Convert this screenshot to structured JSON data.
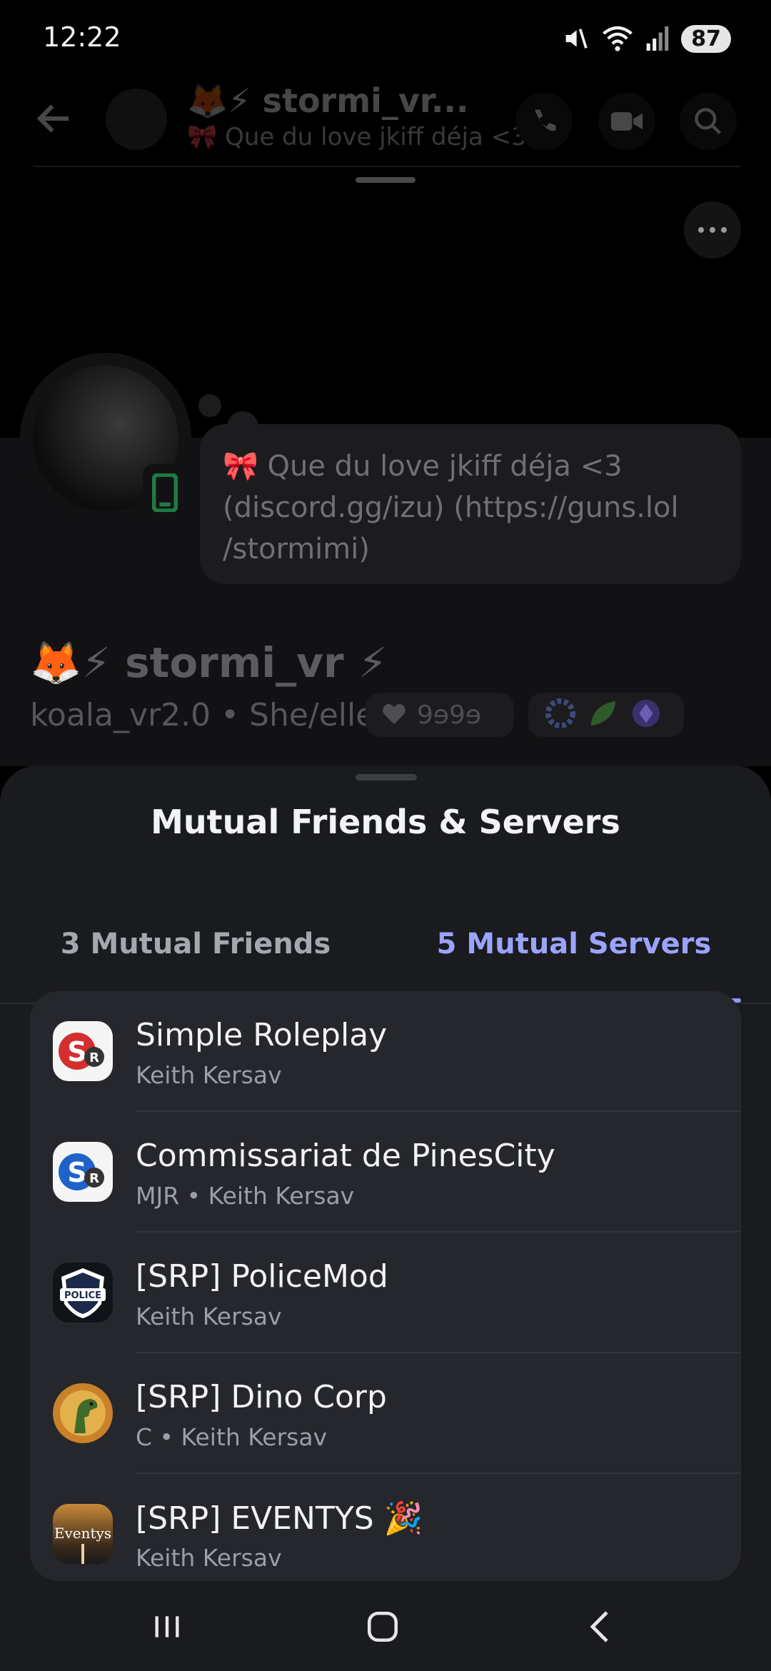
{
  "status_bar": {
    "time": "12:22",
    "battery": "87",
    "icons": [
      "mute-icon",
      "wifi-icon",
      "signal-icon"
    ]
  },
  "chat_header": {
    "name": "🦊⚡ stormi_vr...",
    "status": "🎀 Que du love jkiff déja <3..."
  },
  "profile": {
    "bio": "🎀  Que du love jkiff déja <3 (discord.gg/izu) (https://guns.lol /stormimi)",
    "display_name": "🦊⚡ stormi_vr ⚡",
    "tagline": "koala_vr2.0 • She/elle",
    "clan_tag": "9ɘ9ɘ"
  },
  "sheet": {
    "title": "Mutual Friends & Servers",
    "tabs": [
      {
        "label": "3 Mutual Friends",
        "selected": false
      },
      {
        "label": "5 Mutual Servers",
        "selected": true
      }
    ],
    "servers": [
      {
        "name": "Simple Roleplay",
        "sub": "Keith Kersav"
      },
      {
        "name": "Commissariat de PinesCity",
        "sub": "MJR • Keith Kersav"
      },
      {
        "name": "[SRP] PoliceMod",
        "sub": "Keith Kersav"
      },
      {
        "name": "[SRP] Dino Corp",
        "sub": "C • Keith Kersav"
      },
      {
        "name": "[SRP] EVENTYS 🎉",
        "sub": "Keith Kersav"
      }
    ],
    "server_icon_text": {
      "police": "POLICE",
      "eventys": "Eventys"
    }
  },
  "colors": {
    "accent": "#9aa4ff",
    "sheet_bg": "#1a1b1f",
    "card_bg": "#26272c",
    "online_green": "#23a55a"
  }
}
